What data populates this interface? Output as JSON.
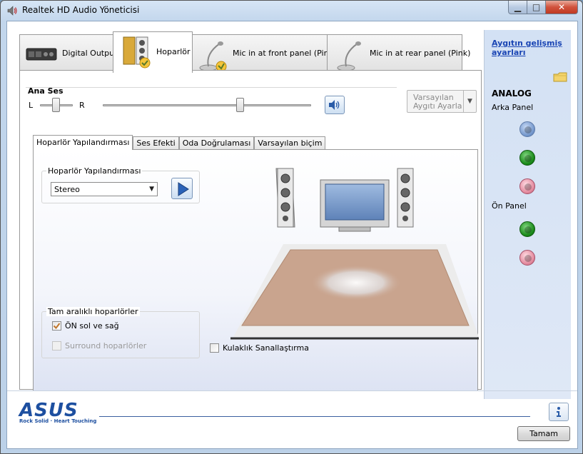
{
  "window": {
    "title": "Realtek HD Audio Yöneticisi"
  },
  "top_tabs": [
    {
      "label": "Digital Output"
    },
    {
      "label": "Hoparlör"
    },
    {
      "label": "Mic in at front panel (Pink)"
    },
    {
      "label": "Mic in at rear panel (Pink)"
    }
  ],
  "master_volume": {
    "label": "Ana Ses",
    "left": "L",
    "right": "R",
    "balance": 0.5,
    "level": 0.66
  },
  "default_device": {
    "line1": "Varsayılan",
    "line2": "Aygıtı Ayarla"
  },
  "sub_tabs": [
    {
      "label": "Hoparlör Yapılandırması"
    },
    {
      "label": "Ses Efekti"
    },
    {
      "label": "Oda Doğrulaması"
    },
    {
      "label": "Varsayılan biçim"
    }
  ],
  "speaker_config": {
    "legend": "Hoparlör Yapılandırması",
    "selected": "Stereo"
  },
  "full_range": {
    "legend": "Tam aralıklı hoparlörler",
    "front": {
      "label": "ÖN sol ve sağ",
      "checked": true
    },
    "surround": {
      "label": "Surround hoparlörler",
      "checked": false,
      "disabled": true
    }
  },
  "headphone_virtualization": {
    "label": "Kulaklık Sanallaştırma",
    "checked": false
  },
  "right_panel": {
    "advanced_link": "Aygıtın gelişmiş ayarları",
    "analog_title": "ANALOG",
    "rear_panel": "Arka Panel",
    "front_panel": "Ön Panel",
    "rear_jacks": [
      "blue",
      "green",
      "pink"
    ],
    "front_jacks": [
      "green",
      "pink"
    ],
    "colors": {
      "blue": "#6f93c9",
      "green": "#1a8a1a",
      "pink": "#e38a9e"
    }
  },
  "branding": {
    "logo": "ASUS",
    "tagline": "Rock Solid · Heart Touching"
  },
  "buttons": {
    "ok": "Tamam"
  }
}
